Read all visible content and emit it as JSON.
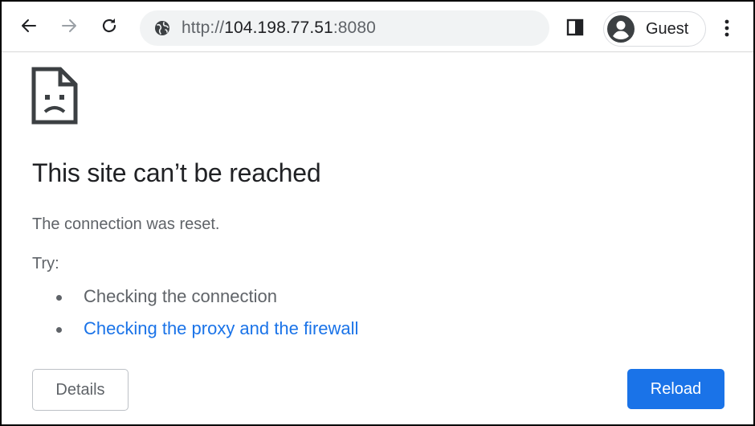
{
  "toolbar": {
    "back_icon": "arrow-left-icon",
    "forward_icon": "arrow-right-icon",
    "reload_icon": "refresh-icon",
    "url": {
      "scheme": "http://",
      "host": "104.198.77.51",
      "port": ":8080"
    },
    "site_info_icon": "globe-icon",
    "side_panel_icon": "side-panel-icon",
    "profile": {
      "label": "Guest",
      "icon": "person-avatar-icon"
    },
    "menu_icon": "three-dot-menu-icon"
  },
  "error_page": {
    "icon": "sad-document-icon",
    "title": "This site can’t be reached",
    "message": "The connection was reset.",
    "try_label": "Try:",
    "suggestions": [
      {
        "text": "Checking the connection",
        "is_link": false
      },
      {
        "text": "Checking the proxy and the firewall",
        "is_link": true
      }
    ],
    "details_label": "Details",
    "reload_label": "Reload"
  },
  "colors": {
    "accent": "#1a73e8",
    "text_primary": "#202124",
    "text_secondary": "#5f6368",
    "omnibox_bg": "#f1f3f4",
    "icon_disabled": "#9aa0a6"
  }
}
